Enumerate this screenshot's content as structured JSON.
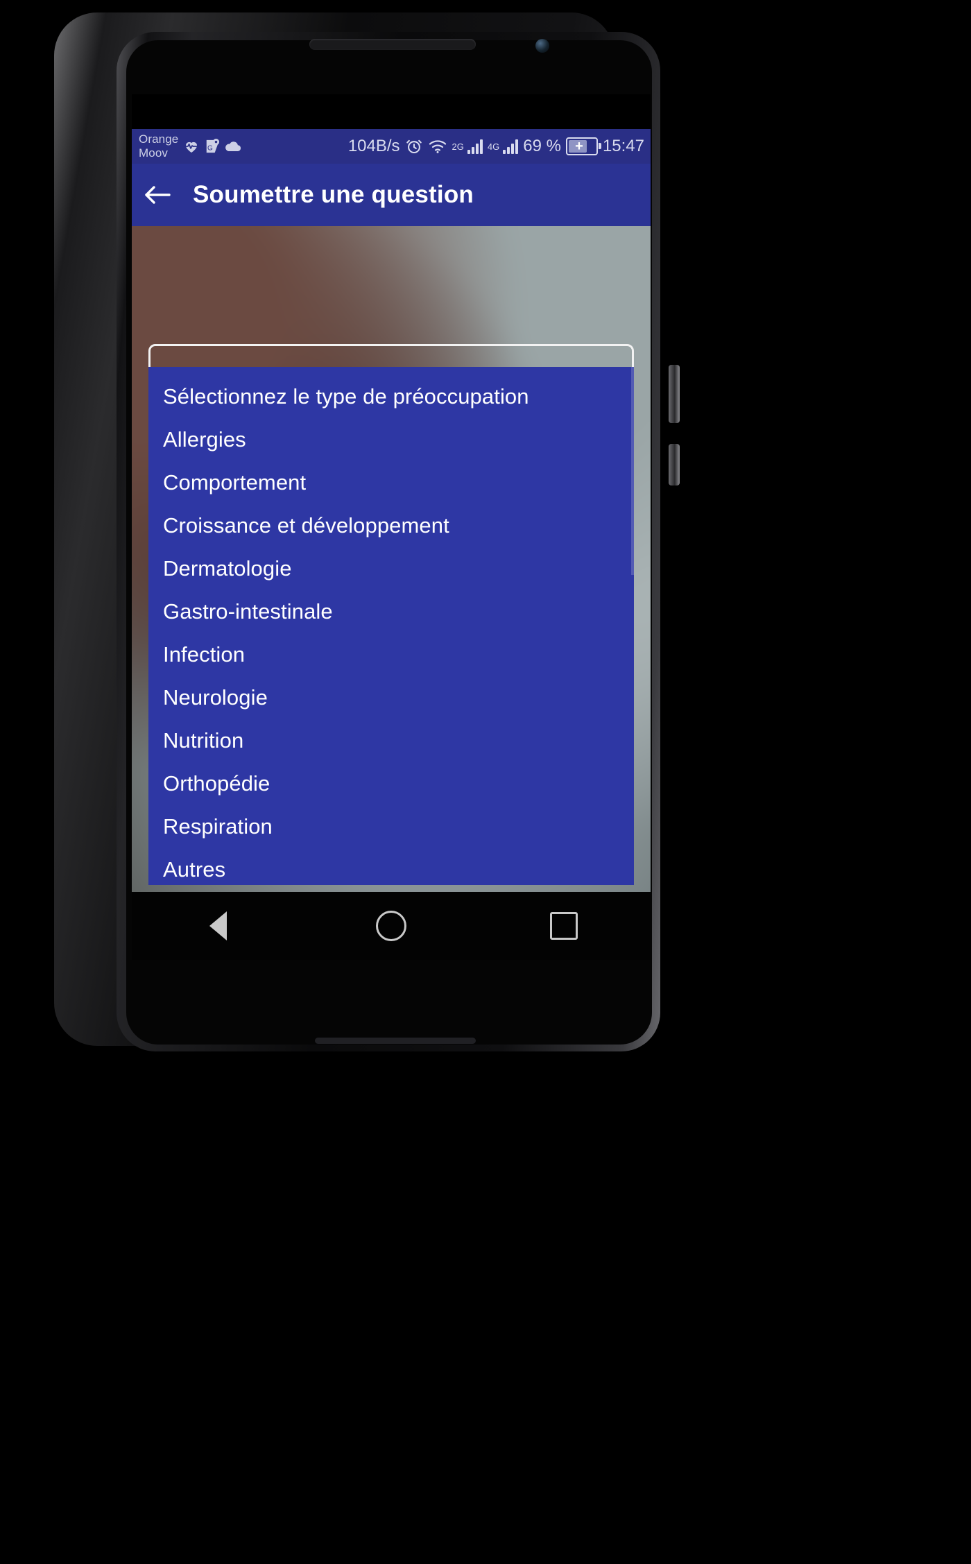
{
  "device": {
    "frame_name": "android-phone",
    "earpiece": "earpiece-speaker",
    "front_camera": "front-camera"
  },
  "status_bar": {
    "carrier": "Orange\nMoov",
    "icons": [
      "heart-pulse-icon",
      "google-maps-icon",
      "cloud-icon"
    ],
    "network_speed": "104B/s",
    "alarm": "alarm-icon",
    "wifi": "wifi-icon",
    "sim1_label": "2G",
    "sim2_label": "4G",
    "battery_percent": "69 %",
    "battery_state": "charging",
    "time": "15:47",
    "background_color": "#2a2f86",
    "foreground_color": "#d9dbef"
  },
  "app_bar": {
    "back_icon": "back-arrow-icon",
    "title": "Soumettre une question",
    "background_color": "#2b3394",
    "text_color": "#ffffff"
  },
  "form": {
    "select_field": {
      "name": "type-de-preoccupation-select",
      "value": "",
      "placeholder": ""
    }
  },
  "dropdown": {
    "open": true,
    "background_color": "#2e37a4",
    "text_color": "#ffffff",
    "items": [
      {
        "label": "Sélectionnez le type de préoccupation",
        "is_placeholder": true
      },
      {
        "label": "Allergies",
        "is_placeholder": false
      },
      {
        "label": "Comportement",
        "is_placeholder": false
      },
      {
        "label": "Croissance et développement",
        "is_placeholder": false
      },
      {
        "label": "Dermatologie",
        "is_placeholder": false
      },
      {
        "label": "Gastro-intestinale",
        "is_placeholder": false
      },
      {
        "label": "Infection",
        "is_placeholder": false
      },
      {
        "label": "Neurologie",
        "is_placeholder": false
      },
      {
        "label": "Nutrition",
        "is_placeholder": false
      },
      {
        "label": "Orthopédie",
        "is_placeholder": false
      },
      {
        "label": "Respiration",
        "is_placeholder": false
      },
      {
        "label": "Autres",
        "is_placeholder": false
      }
    ]
  },
  "nav_bar": {
    "back": "nav-back-icon",
    "home": "nav-home-icon",
    "recents": "nav-recents-icon",
    "background_color": "#030303"
  }
}
